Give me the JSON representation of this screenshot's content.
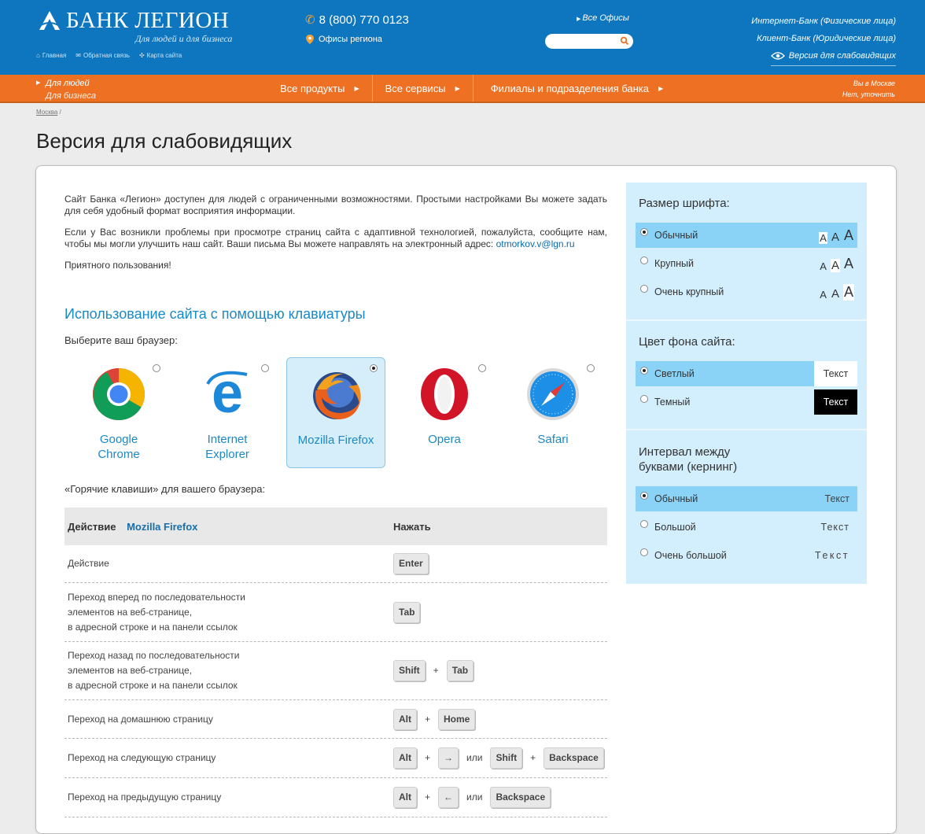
{
  "colors": {
    "header_blue": "#0e76bf",
    "nav_orange": "#ee7123",
    "accent_blue": "#1a89c4",
    "panel_bg": "#d3eefc",
    "panel_selected": "#8ad3f7"
  },
  "header": {
    "logo_text": "БАНК ЛЕГИОН",
    "tagline": "Для людей и для бизнеса",
    "mini_links": {
      "home": "Главная",
      "feedback": "Обратная связь",
      "sitemap": "Карта сайта"
    },
    "phone": "8 (800) 770 0123",
    "regional_offices": "Офисы региона",
    "all_offices": "Все Офисы",
    "search_placeholder": "",
    "internet_bank": "Интернет-Банк (Физические лица)",
    "client_bank": "Клиент-Банк (Юридические лица)",
    "vision_version": "Версия для слабовидящих"
  },
  "navbar": {
    "audience_people": "Для людей",
    "audience_business": "Для бизнеса",
    "items": [
      "Все продукты",
      "Все сервисы",
      "Филиалы и подразделения банка"
    ],
    "city_line1": "Вы в Москве",
    "city_line2": "Нет, уточнить"
  },
  "breadcrumb": {
    "city": "Москва",
    "separator": "/"
  },
  "page_title": "Версия для слабовидящих",
  "intro": {
    "p1": "Сайт Банка «Легион» доступен для людей с ограниченными возможностями. Простыми настройками Вы можете задать для себя удобный формат восприятия информации.",
    "p2": "Если у Вас возникли проблемы при просмотре страниц сайта с адаптивной технологией, пожалуйста, сообщите нам, чтобы мы могли улучшить наш сайт. Ваши письма Вы можете направлять на электронный адрес:",
    "email": "otmorkov.v@lgn.ru",
    "p3": "Приятного пользования!"
  },
  "keyboard": {
    "heading": "Использование сайта с помощью клавиатуры",
    "choose_browser": "Выберите ваш браузер:",
    "browsers": [
      {
        "name_line1": "Google",
        "name_line2": "Chrome",
        "selected": false,
        "icon": "chrome-icon"
      },
      {
        "name_line1": "Internet",
        "name_line2": "Explorer",
        "selected": false,
        "icon": "ie-icon"
      },
      {
        "name_line1": "",
        "name_line2": "Mozilla Firefox",
        "selected": true,
        "icon": "firefox-icon"
      },
      {
        "name_line1": "Opera",
        "name_line2": "",
        "selected": false,
        "icon": "opera-icon"
      },
      {
        "name_line1": "Safari",
        "name_line2": "",
        "selected": false,
        "icon": "safari-icon"
      }
    ],
    "hotkeys_label": "«Горячие клавиши» для вашего браузера:",
    "table": {
      "col_action": "Действие",
      "col_browser": "Mozilla Firefox",
      "col_press": "Нажать",
      "rows": [
        {
          "action_lines": [
            "Действие"
          ],
          "keys": [
            "Enter"
          ]
        },
        {
          "action_lines": [
            "Переход вперед по последовательности",
            "элементов на веб-странице,",
            "в адресной строке и на панели ссылок"
          ],
          "keys": [
            "Tab"
          ]
        },
        {
          "action_lines": [
            "Переход назад по последовательности",
            "элементов на веб-странице,",
            "в адресной строке и на панели ссылок"
          ],
          "keys": [
            "Shift",
            "+",
            "Tab"
          ]
        },
        {
          "action_lines": [
            "Переход на домашнюю страницу"
          ],
          "keys": [
            "Alt",
            "+",
            "Home"
          ]
        },
        {
          "action_lines": [
            "Переход на следующую страницу"
          ],
          "keys": [
            "Alt",
            "+",
            "→",
            "или",
            "Shift",
            "+",
            "Backspace"
          ]
        },
        {
          "action_lines": [
            "Переход на предыдущую страницу"
          ],
          "keys": [
            "Alt",
            "+",
            "←",
            "или",
            "Backspace"
          ]
        }
      ]
    }
  },
  "settings": {
    "font_size": {
      "title": "Размер шрифта:",
      "sample_letter": "A",
      "options": [
        {
          "label": "Обычный",
          "selected": true
        },
        {
          "label": "Крупный",
          "selected": false
        },
        {
          "label": "Очень крупный",
          "selected": false
        }
      ]
    },
    "bg_color": {
      "title": "Цвет фона сайта:",
      "options": [
        {
          "label": "Светлый",
          "sample": "Текст",
          "selected": true
        },
        {
          "label": "Темный",
          "sample": "Текст",
          "selected": false
        }
      ]
    },
    "kerning": {
      "title_line1": "Интервал между",
      "title_line2": "буквами (кернинг)",
      "options": [
        {
          "label": "Обычный",
          "sample": "Текст",
          "selected": true
        },
        {
          "label": "Большой",
          "sample": "Текст",
          "selected": false
        },
        {
          "label": "Очень большой",
          "sample": "Текст",
          "selected": false
        }
      ]
    }
  }
}
